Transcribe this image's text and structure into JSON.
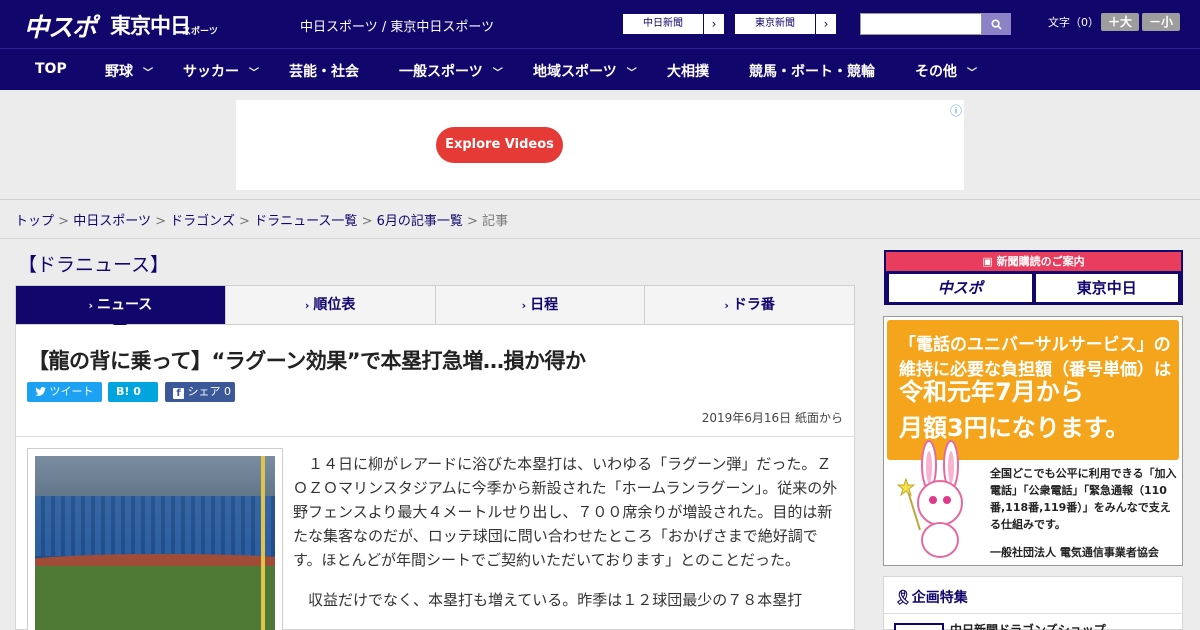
{
  "header": {
    "logo_main": "中スポ",
    "logo_tokyo": "東京中日",
    "logo_tokyo_sub": "スポーツ",
    "site_title": "中日スポーツ / 東京中日スポーツ",
    "btn_chunichi": "中日新聞",
    "btn_tokyo": "東京新聞",
    "search_placeholder": "",
    "font_label": "文字（0）",
    "font_larger": "＋大",
    "font_smaller": "－小"
  },
  "nav": {
    "items": [
      {
        "label": "TOP",
        "has_menu": false
      },
      {
        "label": "野球",
        "has_menu": true
      },
      {
        "label": "サッカー",
        "has_menu": true
      },
      {
        "label": "芸能・社会",
        "has_menu": false
      },
      {
        "label": "一般スポーツ",
        "has_menu": true
      },
      {
        "label": "地域スポーツ",
        "has_menu": true
      },
      {
        "label": "大相撲",
        "has_menu": false
      },
      {
        "label": "競馬・ボート・競輪",
        "has_menu": false
      },
      {
        "label": "その他",
        "has_menu": true
      }
    ]
  },
  "ad": {
    "button_label": "Explore Videos",
    "info_icon": "info-icon"
  },
  "breadcrumb": {
    "items": [
      "トップ",
      "中日スポーツ",
      "ドラゴンズ",
      "ドラニュース一覧",
      "6月の記事一覧"
    ],
    "current": "記事",
    "separator": ">"
  },
  "section": {
    "title": "【ドラニュース】"
  },
  "tabs": [
    {
      "label": "ニュース",
      "active": true
    },
    {
      "label": "順位表",
      "active": false
    },
    {
      "label": "日程",
      "active": false
    },
    {
      "label": "ドラ番",
      "active": false
    }
  ],
  "article": {
    "headline": "【龍の背に乗って】“ラグーン効果”で本塁打急増…損か得か",
    "share_tweet": "ツイート",
    "share_hatena": "B! 0",
    "share_facebook": "シェア 0",
    "dateline": "2019年6月16日 紙面から",
    "paragraphs": [
      "１４日に柳がレアードに浴びた本塁打は、いわゆる「ラグーン弾」だった。ＺＯＺＯマリンスタジアムに今季から新設された「ホームランラグーン」。従来の外野フェンスより最大４メートルせり出し、７００席余りが増設された。目的は新たな集客なのだが、ロッテ球団に問い合わせたところ「おかげさまで絶好調です。ほとんどが年間シートでご契約いただいております」とのことだった。",
      "収益だけでなく、本塁打も増えている。昨季は１２球団最少の７８本塁打"
    ]
  },
  "sidebar": {
    "subscribe_head": "新聞購読のご案内",
    "subscribe_logo1": "中スポ",
    "subscribe_logo2": "東京中日",
    "promo_line1": "「電話のユニバーサルサービス」の",
    "promo_line1b": "維持に必要な負担額（番号単価）は",
    "promo_line2": "令和元年7月から",
    "promo_line3": "月額3円になります。",
    "promo_small": "全国どこでも公平に利用できる「加入電話」「公衆電話」「緊急通報（110番,118番,119番）」をみんなで支える仕組みです。",
    "promo_org": "一般社団法人 電気通信事業者協会",
    "feature_title": "企画特集",
    "feature_item": "中日新聞ドラゴンズショップ"
  },
  "colors": {
    "brand_navy": "#11066c",
    "ad_red": "#e63a36",
    "promo_orange": "#f5a51c",
    "subscribe_pink": "#e83d5d"
  }
}
